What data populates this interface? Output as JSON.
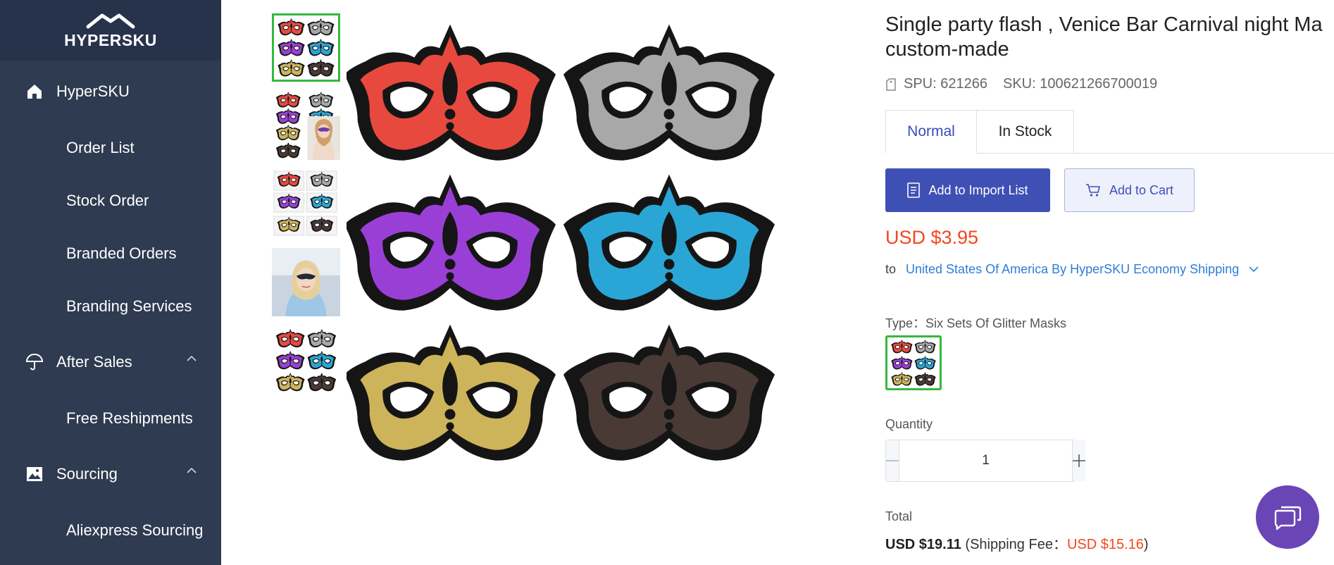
{
  "sidebar": {
    "logo_text": "HYPERSKU",
    "items": [
      {
        "label": "HyperSKU",
        "icon": "home-icon"
      },
      {
        "label": "Order List"
      },
      {
        "label": "Stock Order"
      },
      {
        "label": "Branded Orders"
      },
      {
        "label": "Branding Services"
      },
      {
        "label": "After Sales",
        "icon": "umbrella-icon"
      },
      {
        "label": "Free Reshipments"
      },
      {
        "label": "Sourcing",
        "icon": "image-icon"
      },
      {
        "label": "Aliexpress Sourcing"
      }
    ]
  },
  "product": {
    "title_line1": "Single party flash , Venice Bar Carnival night Ma",
    "title_line2": "custom-made",
    "spu": "SPU: 621266",
    "sku": "SKU: 100621266700019",
    "tabs": [
      "Normal",
      "In Stock"
    ],
    "active_tab": "Normal",
    "import_button": "Add to Import List",
    "cart_button": "Add to Cart",
    "price": "USD $3.95",
    "shipping_to": "to",
    "shipping_method": "United States Of America By HyperSKU Economy Shipping",
    "type_label": "Type：Six Sets Of Glitter Masks",
    "quantity_label": "Quantity",
    "quantity": "1",
    "total_label": "Total",
    "total_amount": "USD $19.11",
    "shipping_fee_prefix": " (Shipping Fee：",
    "shipping_fee": "USD $15.16",
    "shipping_fee_suffix": ")"
  },
  "mask_colors": [
    "#e8493f",
    "#a8a8a8",
    "#9a3fd6",
    "#2aa6d6",
    "#cdb45a",
    "#4a3a36"
  ],
  "colors": {
    "sidebar_bg": "#2e3b50",
    "accent": "#3f50b5",
    "price": "#f5461e",
    "link": "#2f7ed8",
    "selected_border": "#34b83f"
  }
}
